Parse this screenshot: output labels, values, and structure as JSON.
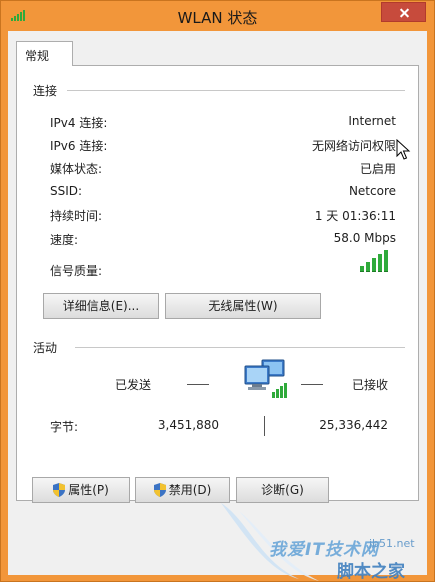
{
  "window": {
    "title": "WLAN 状态"
  },
  "tabs": [
    {
      "label": "常规"
    }
  ],
  "connection": {
    "title": "连接",
    "rows": [
      {
        "label": "IPv4 连接:",
        "value": "Internet"
      },
      {
        "label": "IPv6 连接:",
        "value": "无网络访问权限"
      },
      {
        "label": "媒体状态:",
        "value": "已启用"
      },
      {
        "label": "SSID:",
        "value": "Netcore"
      },
      {
        "label": "持续时间:",
        "value": "1 天 01:36:11"
      },
      {
        "label": "速度:",
        "value": "58.0 Mbps"
      }
    ],
    "signal_label": "信号质量:",
    "signal_bars": 5,
    "signal_bars_max": 5,
    "details_button": "详细信息(E)...",
    "wireless_props_button": "无线属性(W)"
  },
  "activity": {
    "title": "活动",
    "sent_label": "已发送",
    "received_label": "已接收",
    "bytes_label": "字节:",
    "bytes_sent": "3,451,880",
    "bytes_received": "25,336,442"
  },
  "footer_buttons": {
    "properties": "属性(P)",
    "disable": "禁用(D)",
    "diagnose": "诊断(G)"
  },
  "watermark": {
    "line1": "我爱IT技术网",
    "line2": "脚本之家",
    "site": "jb51.net"
  },
  "colors": {
    "titlebar": "#f2963a",
    "close": "#c74b3c",
    "signal": "#2faa3b"
  }
}
